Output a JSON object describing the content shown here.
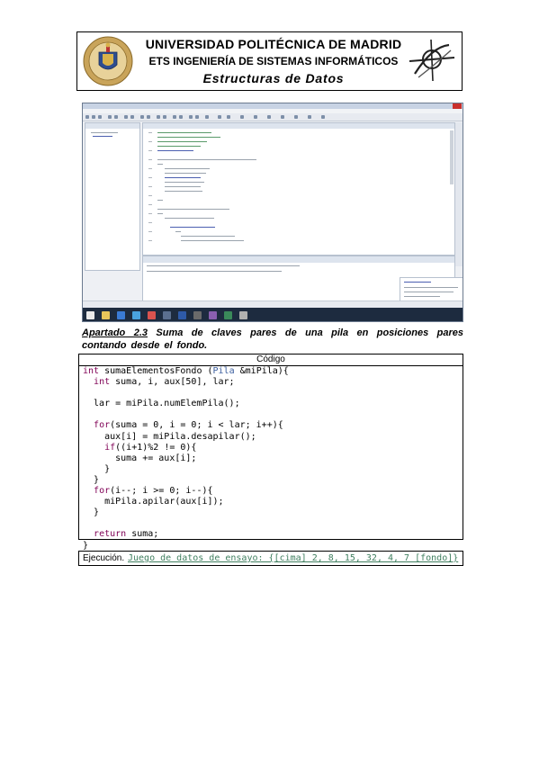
{
  "header": {
    "university": "UNIVERSIDAD POLITÉCNICA DE MADRID",
    "school": "ETS INGENIERÍA DE SISTEMAS INFORMÁTICOS",
    "subject": "Estructuras de Datos",
    "left_logo_icon": "upm-seal-icon",
    "right_logo_icon": "etsisi-logo-icon"
  },
  "screenshot": {
    "description_icon": "eclipse-ide-screenshot-icon",
    "accent": "#1d2b3f"
  },
  "caption": {
    "number": "Apartado 2.3",
    "text": "Suma de claves pares de una pila en posiciones pares contando desde el fondo."
  },
  "code": {
    "header": "Código",
    "lines": [
      [
        {
          "t": "int ",
          "c": "kw"
        },
        {
          "t": "sumaElementosFondo (",
          "c": ""
        },
        {
          "t": "Pila",
          "c": "cls"
        },
        {
          "t": " &miPila){",
          "c": ""
        }
      ],
      [
        {
          "t": "  ",
          "c": ""
        },
        {
          "t": "int",
          "c": "kw"
        },
        {
          "t": " suma, i, aux[50], lar;",
          "c": ""
        }
      ],
      [
        {
          "t": "",
          "c": ""
        }
      ],
      [
        {
          "t": "  lar = miPila.numElemPila();",
          "c": ""
        }
      ],
      [
        {
          "t": "",
          "c": ""
        }
      ],
      [
        {
          "t": "  ",
          "c": ""
        },
        {
          "t": "for",
          "c": "kw"
        },
        {
          "t": "(suma = 0, i = 0; i < lar; i++){",
          "c": ""
        }
      ],
      [
        {
          "t": "    aux[i] = miPila.desapilar();",
          "c": ""
        }
      ],
      [
        {
          "t": "    ",
          "c": ""
        },
        {
          "t": "if",
          "c": "kw"
        },
        {
          "t": "((i+1)%2 != 0){",
          "c": ""
        }
      ],
      [
        {
          "t": "      suma += aux[i];",
          "c": ""
        }
      ],
      [
        {
          "t": "    }",
          "c": ""
        }
      ],
      [
        {
          "t": "  }",
          "c": ""
        }
      ],
      [
        {
          "t": "  ",
          "c": ""
        },
        {
          "t": "for",
          "c": "kw"
        },
        {
          "t": "(i--; i >= 0; i--){",
          "c": ""
        }
      ],
      [
        {
          "t": "    miPila.apilar(aux[i]);",
          "c": ""
        }
      ],
      [
        {
          "t": "  }",
          "c": ""
        }
      ],
      [
        {
          "t": "",
          "c": ""
        }
      ],
      [
        {
          "t": "  ",
          "c": ""
        },
        {
          "t": "return",
          "c": "kw"
        },
        {
          "t": " suma;",
          "c": ""
        }
      ],
      [
        {
          "t": "}",
          "c": ""
        }
      ]
    ]
  },
  "execution": {
    "label": "Ejecución.",
    "value": "Juego de datos de ensayo: {[cima] 2, 8, 15, 32, 4, 7 [fondo]}"
  },
  "colors": {
    "keyword": "#7f0055",
    "class": "#3b5e9e",
    "execution_text": "#3f7f5f"
  }
}
